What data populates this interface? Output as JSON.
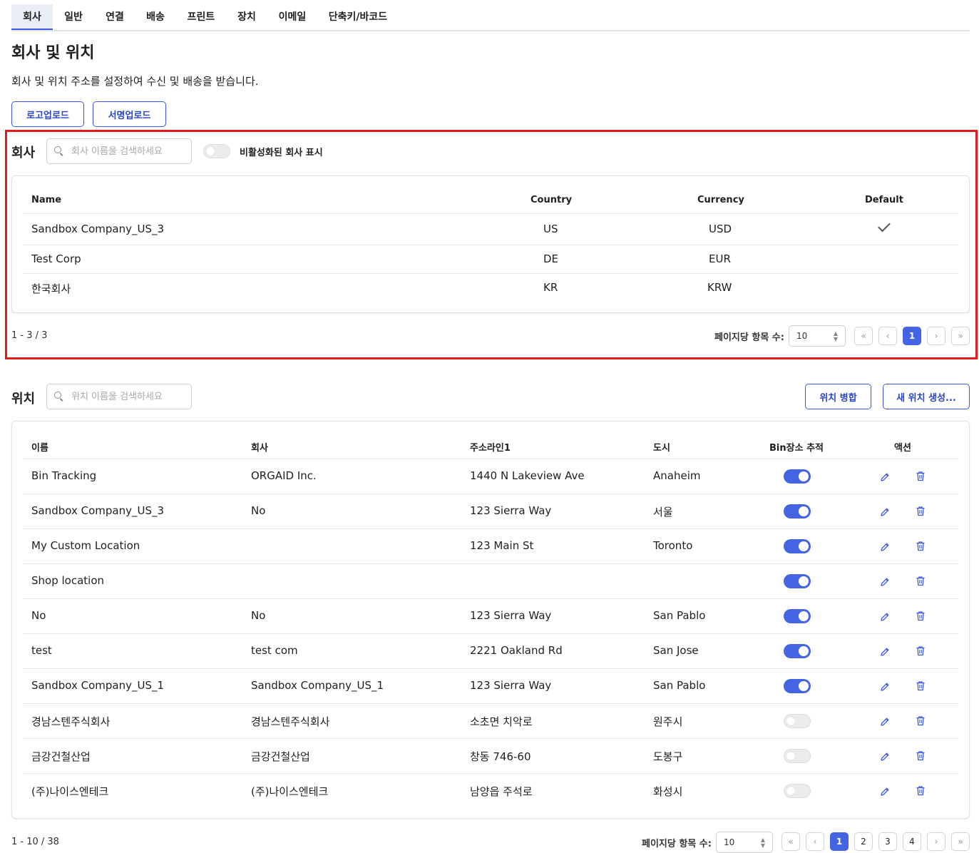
{
  "tabs": [
    {
      "label": "회사",
      "active": true
    },
    {
      "label": "일반"
    },
    {
      "label": "연결"
    },
    {
      "label": "배송"
    },
    {
      "label": "프린트"
    },
    {
      "label": "장치"
    },
    {
      "label": "이메일"
    },
    {
      "label": "단축키/바코드"
    }
  ],
  "page": {
    "title": "회사 및 위치",
    "description": "회사 및 위치 주소를 설정하여 수신 및 배송을 받습니다.",
    "upload_logo": "로고업로드",
    "upload_signature": "서명업로드"
  },
  "company": {
    "title": "회사",
    "search_placeholder": "회사 이름을 검색하세요",
    "show_inactive_label": "비활성화된 회사 표시",
    "columns": {
      "name": "Name",
      "country": "Country",
      "currency": "Currency",
      "default": "Default"
    },
    "rows": [
      {
        "name": "Sandbox Company_US_3",
        "country": "US",
        "currency": "USD",
        "default": true
      },
      {
        "name": "Test Corp",
        "country": "DE",
        "currency": "EUR",
        "default": false
      },
      {
        "name": "한국회사",
        "country": "KR",
        "currency": "KRW",
        "default": false
      }
    ],
    "pagination": {
      "range": "1 - 3 / 3",
      "per_page_label": "페이지당 항목 수:",
      "per_page": "10",
      "pages": [
        "1"
      ],
      "current": "1"
    }
  },
  "location": {
    "title": "위치",
    "search_placeholder": "위치 이름을 검색하세요",
    "merge_button": "위치 병합",
    "create_button": "새 위치 생성...",
    "columns": {
      "name": "이름",
      "company": "회사",
      "address": "주소라인1",
      "city": "도시",
      "bin": "Bin장소 추적",
      "action": "액션"
    },
    "rows": [
      {
        "name": "Bin Tracking",
        "company": "ORGAID Inc.",
        "address": "1440 N Lakeview Ave",
        "city": "Anaheim",
        "bin": true
      },
      {
        "name": "Sandbox Company_US_3",
        "company": "No",
        "address": "123 Sierra Way",
        "city": "서울",
        "bin": true
      },
      {
        "name": "My Custom Location",
        "company": "",
        "address": "123 Main St",
        "city": "Toronto",
        "bin": true
      },
      {
        "name": "Shop location",
        "company": "",
        "address": "",
        "city": "",
        "bin": true
      },
      {
        "name": "No",
        "company": "No",
        "address": "123 Sierra Way",
        "city": "San Pablo",
        "bin": true
      },
      {
        "name": "test",
        "company": "test com",
        "address": "2221 Oakland Rd",
        "city": "San Jose",
        "bin": true
      },
      {
        "name": "Sandbox Company_US_1",
        "company": "Sandbox Company_US_1",
        "address": "123 Sierra Way",
        "city": "San Pablo",
        "bin": true
      },
      {
        "name": "경남스텐주식회사",
        "company": "경남스텐주식회사",
        "address": "소초면 치악로",
        "city": "원주시",
        "bin": false
      },
      {
        "name": "금강건철산업",
        "company": "금강건철산업",
        "address": "창동 746-60",
        "city": "도봉구",
        "bin": false
      },
      {
        "name": "(주)나이스엔테크",
        "company": "(주)나이스엔테크",
        "address": "남양읍 주석로",
        "city": "화성시",
        "bin": false
      }
    ],
    "pagination": {
      "range": "1 - 10 / 38",
      "per_page_label": "페이지당 항목 수:",
      "per_page": "10",
      "pages": [
        "1",
        "2",
        "3",
        "4"
      ],
      "current": "1"
    }
  },
  "colors": {
    "accent": "#4564e4",
    "highlight": "#e01b1b"
  },
  "icons": [
    "search-icon",
    "check-icon",
    "edit-icon",
    "trash-icon",
    "chevron-double-left-icon",
    "chevron-left-icon",
    "chevron-right-icon",
    "chevron-double-right-icon"
  ]
}
